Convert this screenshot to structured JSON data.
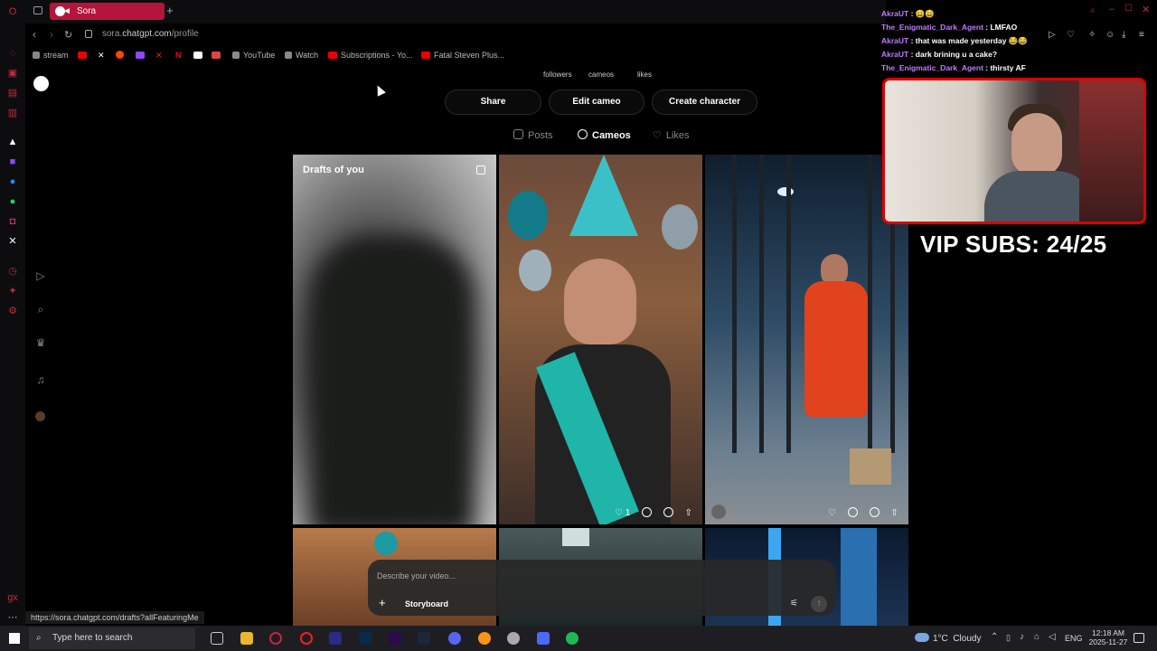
{
  "browser": {
    "tab_title": "Sora",
    "url_prefix": "sora.",
    "url_domain": "chatgpt.com",
    "url_path": "/profile",
    "bookmarks": [
      "stream",
      "YouTube",
      "Watch",
      "Subscriptions - Yo...",
      "Fatal Steven Plus..."
    ],
    "status_url": "https://sora.chatgpt.com/drafts?allFeaturingMe"
  },
  "profile": {
    "stat_labels": [
      "followers",
      "cameos",
      "likes"
    ],
    "buttons": {
      "share": "Share",
      "edit_cameo": "Edit cameo",
      "create_character": "Create character"
    },
    "tabs": {
      "posts": "Posts",
      "cameos": "Cameos",
      "likes": "Likes"
    }
  },
  "grid": {
    "drafts_title": "Drafts of you",
    "birthday_like_count": "1"
  },
  "composer": {
    "placeholder": "Describe your video...",
    "storyboard": "Storyboard"
  },
  "stream_overlay": {
    "chat": [
      {
        "user": "AkraUT",
        "msg": "😄😄"
      },
      {
        "user": "The_Enigmatic_Dark_Agent",
        "msg": "LMFAO"
      },
      {
        "user": "AkraUT",
        "msg": "that was made yesterday 😂😂"
      },
      {
        "user": "AkraUT",
        "msg": "dark brining u a cake?"
      },
      {
        "user": "The_Enigmatic_Dark_Agent",
        "msg": "thirsty AF"
      }
    ],
    "vip_text": "VIP SUBS: 24/25"
  },
  "taskbar": {
    "search_placeholder": "Type here to search",
    "weather": "1°C  Cloudy",
    "language": "ENG",
    "time": "12:18 AM",
    "date": "2025-11-27"
  },
  "colors": {
    "opera_red": "#c5283d",
    "tab_active": "#b3163a",
    "chat_user": "#c07bff",
    "webcam_border": "#dd0000"
  }
}
